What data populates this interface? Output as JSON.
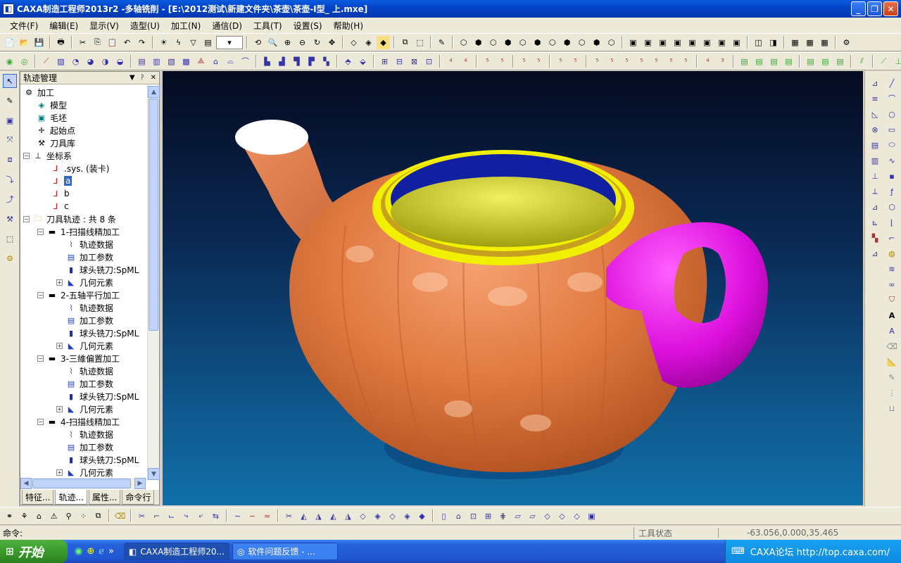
{
  "window": {
    "title": "CAXA制造工程师2013r2 -多轴铣削 - [E:\\2012测试\\新建文件夹\\茶壶\\茶壶-I型_ 上.mxe]",
    "min": "_",
    "max": "❐",
    "close": "✕"
  },
  "menu": [
    "文件(F)",
    "编辑(E)",
    "显示(V)",
    "造型(U)",
    "加工(N)",
    "通信(D)",
    "工具(T)",
    "设置(S)",
    "帮助(H)"
  ],
  "panel": {
    "title": "轨迹管理",
    "tabs": [
      "特征...",
      "轨迹...",
      "属性...",
      "命令行"
    ],
    "tree": [
      {
        "label": "加工",
        "icon": "machining-icon"
      },
      {
        "label": "模型",
        "icon": "model-icon"
      },
      {
        "label": "毛坯",
        "icon": "blank-icon"
      },
      {
        "label": "起始点",
        "icon": "start-point-icon"
      },
      {
        "label": "刀具库",
        "icon": "tool-library-icon"
      },
      {
        "label": "坐标系",
        "icon": "coordinate-icon"
      },
      {
        "label": ".sys. (装卡)",
        "icon": "axis-icon"
      },
      {
        "label": "a",
        "icon": "axis-icon"
      },
      {
        "label": "b",
        "icon": "axis-icon"
      },
      {
        "label": "c",
        "icon": "axis-icon"
      },
      {
        "label": "刀具轨迹 : 共 8 条",
        "icon": "folder-icon"
      },
      {
        "label": "1-扫描线精加工",
        "icon": "operation-icon"
      },
      {
        "label": "轨迹数据",
        "icon": "path-data-icon"
      },
      {
        "label": "加工参数",
        "icon": "params-icon"
      },
      {
        "label": "球头铣刀:SpML",
        "icon": "ball-mill-icon"
      },
      {
        "label": "几何元素",
        "icon": "geometry-icon"
      },
      {
        "label": "2-五轴平行加工",
        "icon": "operation-icon"
      },
      {
        "label": "轨迹数据",
        "icon": "path-data-icon"
      },
      {
        "label": "加工参数",
        "icon": "params-icon"
      },
      {
        "label": "球头铣刀:SpML",
        "icon": "ball-mill-icon"
      },
      {
        "label": "几何元素",
        "icon": "geometry-icon"
      },
      {
        "label": "3-三維偏置加工",
        "icon": "operation-icon"
      },
      {
        "label": "轨迹数据",
        "icon": "path-data-icon"
      },
      {
        "label": "加工参数",
        "icon": "params-icon"
      },
      {
        "label": "球头铣刀:SpML",
        "icon": "ball-mill-icon"
      },
      {
        "label": "几何元素",
        "icon": "geometry-icon"
      },
      {
        "label": "4-扫描线精加工",
        "icon": "operation-icon"
      },
      {
        "label": "轨迹数据",
        "icon": "path-data-icon"
      },
      {
        "label": "加工参数",
        "icon": "params-icon"
      },
      {
        "label": "球头铣刀:SpML",
        "icon": "ball-mill-icon"
      },
      {
        "label": "几何元素",
        "icon": "geometry-icon"
      }
    ]
  },
  "status": {
    "command_label": "命令:",
    "tool_state": "工具状态",
    "coords": "-63.056,0.000,35.465"
  },
  "taskbar": {
    "start": "开始",
    "items": [
      "CAXA制造工程师20...",
      "软件问题反馈 - ..."
    ],
    "tray_text": "CAXA论坛 http://top.caxa.com/"
  },
  "colors": {
    "teapot_body": "#e07a40",
    "handle": "#dd10dd",
    "rim": "#f0f000",
    "interior": "#1020a0",
    "liquid": "#d8d820"
  }
}
